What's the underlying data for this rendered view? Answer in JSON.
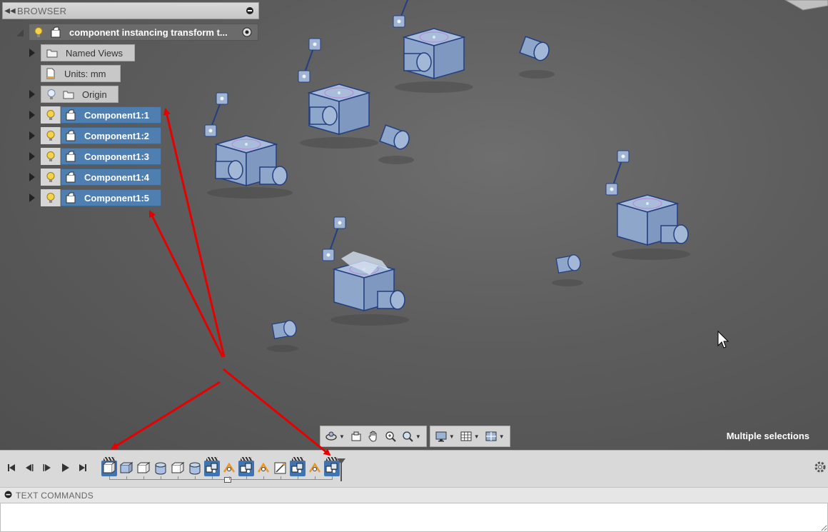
{
  "browser": {
    "title": "BROWSER",
    "root": {
      "label": "component instancing transform t..."
    },
    "named_views": {
      "label": "Named Views"
    },
    "units": {
      "label": "Units: mm"
    },
    "origin": {
      "label": "Origin"
    },
    "components": [
      {
        "label": "Component1:1"
      },
      {
        "label": "Component1:2"
      },
      {
        "label": "Component1:3"
      },
      {
        "label": "Component1:4"
      },
      {
        "label": "Component1:5"
      }
    ]
  },
  "status": {
    "text": "Multiple selections"
  },
  "text_commands": {
    "title": "TEXT COMMANDS",
    "value": ""
  },
  "colors": {
    "selection": "#4e7fb0",
    "part_fill": "#8fa6c9",
    "part_edge": "#233f80",
    "annotation_arrow": "#e60000"
  },
  "timeline": {
    "features": [
      {
        "icon": "new-component-icon",
        "highlighted": true
      },
      {
        "icon": "extrude-icon",
        "highlighted": false
      },
      {
        "icon": "box-icon",
        "highlighted": false
      },
      {
        "icon": "cylinder-icon",
        "highlighted": false
      },
      {
        "icon": "box-icon",
        "highlighted": false
      },
      {
        "icon": "cylinder-icon",
        "highlighted": false
      },
      {
        "icon": "component-pattern-icon",
        "highlighted": true
      },
      {
        "icon": "joint-icon",
        "highlighted": false
      },
      {
        "icon": "component-pattern-icon",
        "highlighted": true
      },
      {
        "icon": "joint-icon",
        "highlighted": false
      },
      {
        "icon": "sketch-icon",
        "highlighted": false
      },
      {
        "icon": "component-pattern-icon",
        "highlighted": true
      },
      {
        "icon": "joint-icon",
        "highlighted": false
      },
      {
        "icon": "component-pattern-icon",
        "highlighted": true
      }
    ]
  }
}
